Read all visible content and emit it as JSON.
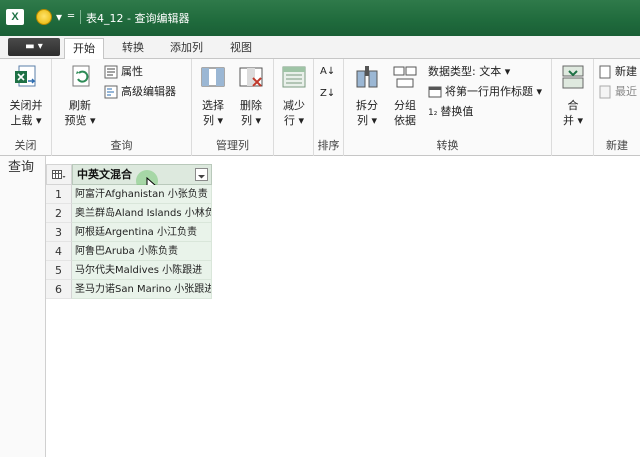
{
  "window": {
    "app_icon": "X",
    "title": "表4_12 - 查询编辑器",
    "qat_dropdown": "▾"
  },
  "tabs": {
    "file": "▬ ▾",
    "items": [
      "开始",
      "转换",
      "添加列",
      "视图"
    ]
  },
  "ribbon": {
    "close": {
      "button": "关闭并上载·",
      "line1": "关闭并",
      "line2": "上载 ▾",
      "group": "关闭"
    },
    "query": {
      "refresh_line1": "刷新",
      "refresh_line2": "预览 ▾",
      "properties": "属性",
      "advanced_editor": "高级编辑器",
      "group": "查询"
    },
    "manage_columns": {
      "choose_line1": "选择",
      "choose_line2": "列 ▾",
      "remove_line1": "删除",
      "remove_line2": "列 ▾",
      "group": "管理列"
    },
    "reduce": {
      "line1": "减少",
      "line2": "行 ▾"
    },
    "sort": {
      "group": "排序"
    },
    "transform": {
      "split_line1": "拆分",
      "split_line2": "列 ▾",
      "group_by_line1": "分组",
      "group_by_line2": "依据",
      "data_type": "数据类型: 文本 ▾",
      "first_row_header": "将第一行用作标题 ▾",
      "replace_values": "替换值",
      "group": "转换"
    },
    "combine": {
      "merge_line1": "合",
      "merge_line2": "并 ▾",
      "new_source": "新建",
      "recent": "最近",
      "group": "新建"
    }
  },
  "sidebar": {
    "label": "查询"
  },
  "table": {
    "column_header": "中英文混合",
    "rows": [
      {
        "num": "1",
        "value": "阿富汗Afghanistan 小张负责"
      },
      {
        "num": "2",
        "value": "奥兰群岛Aland Islands 小林负"
      },
      {
        "num": "3",
        "value": "阿根廷Argentina 小江负责"
      },
      {
        "num": "4",
        "value": "阿鲁巴Aruba 小陈负责"
      },
      {
        "num": "5",
        "value": "马尔代夫Maldives 小陈跟进"
      },
      {
        "num": "6",
        "value": "圣马力诺San Marino 小张跟进"
      }
    ]
  },
  "colors": {
    "title_bar": "#1f6a3c",
    "column_selected": "#e9f3ea",
    "header_selected": "#dde9de"
  }
}
